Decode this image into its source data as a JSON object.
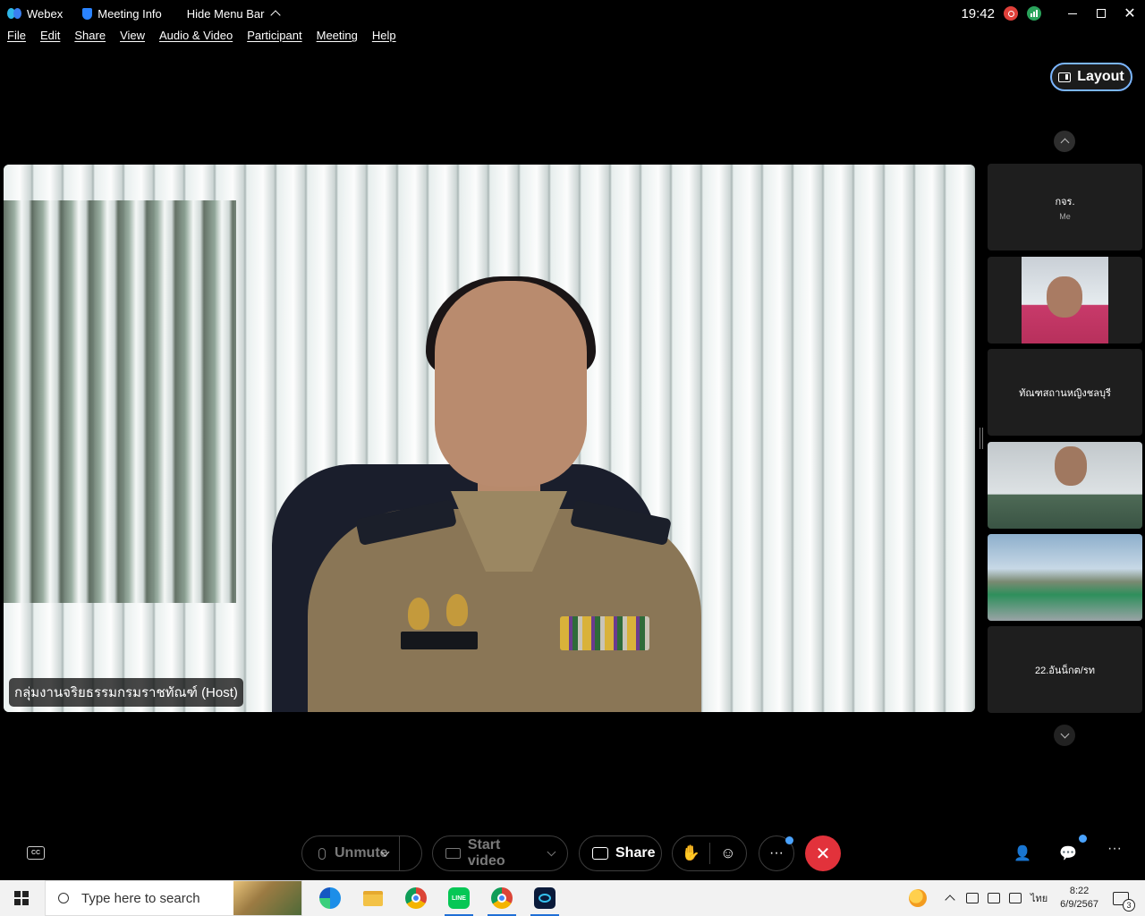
{
  "titlebar": {
    "app_name": "Webex",
    "meeting_info": "Meeting Info",
    "hide_menu_bar": "Hide Menu Bar",
    "time": "19:42"
  },
  "menu": [
    "File",
    "Edit",
    "Share",
    "View",
    "Audio & Video",
    "Participant",
    "Meeting",
    "Help"
  ],
  "layout_button": "Layout",
  "main_video": {
    "name_label": "กลุ่มงานจริยธรรมกรมราชทัณฑ์ (Host)"
  },
  "participants": [
    {
      "name": "กจร.",
      "sub": "Me",
      "video": false
    },
    {
      "name": "",
      "sub": "",
      "video": true
    },
    {
      "name": "ทัณฑสถานหญิงชลบุรี",
      "sub": "",
      "video": false
    },
    {
      "name": "",
      "sub": "",
      "video": true
    },
    {
      "name": "",
      "sub": "",
      "video": true
    },
    {
      "name": "22.อันน็กต/รท",
      "sub": "",
      "video": false
    }
  ],
  "controls": {
    "unmute": "Unmute",
    "start_video": "Start video",
    "share": "Share"
  },
  "taskbar": {
    "search_placeholder": "Type here to search",
    "language": "ไทย",
    "time": "8:22",
    "date": "6/9/2567",
    "notification_count": "3"
  },
  "colors": {
    "end_call": "#e2323b",
    "layout_border": "#7bb6ff",
    "recording": "#e0403a",
    "network": "#2aa35b"
  }
}
